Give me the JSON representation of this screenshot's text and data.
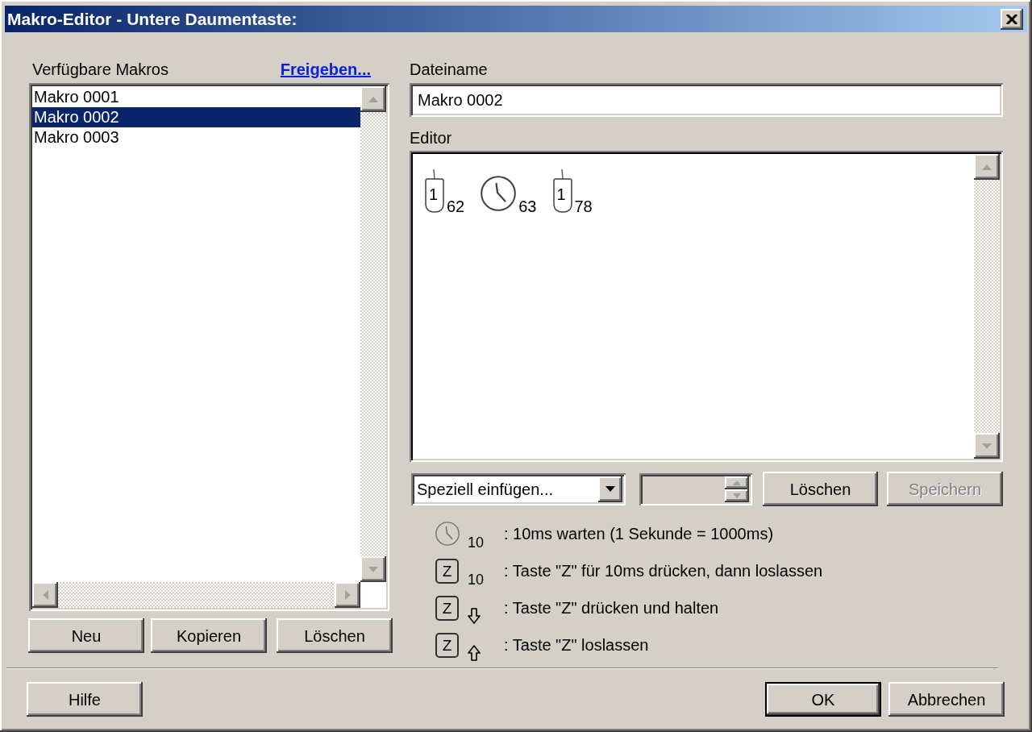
{
  "window": {
    "title": "Makro-Editor - Untere Daumentaste:"
  },
  "macros": {
    "label": "Verfügbare Makros",
    "share_link": "Freigeben...",
    "items": [
      {
        "name": "Makro 0001",
        "selected": false
      },
      {
        "name": "Makro 0002",
        "selected": true
      },
      {
        "name": "Makro 0003",
        "selected": false
      }
    ],
    "buttons": [
      {
        "label": "Neu"
      },
      {
        "label": "Kopieren"
      },
      {
        "label": "Löschen"
      }
    ]
  },
  "filename": {
    "label": "Dateiname",
    "value": "Makro 0002"
  },
  "editor": {
    "label": "Editor",
    "steps": [
      {
        "kind": "mouse",
        "button": "1",
        "value": "62"
      },
      {
        "kind": "wait",
        "value": "63"
      },
      {
        "kind": "mouse",
        "button": "1",
        "value": "78"
      }
    ]
  },
  "editor_controls": {
    "insert_dropdown": {
      "value": "Speziell einfügen..."
    },
    "spinner": {
      "disabled": true
    },
    "buttons": [
      {
        "label": "Löschen",
        "disabled": false
      },
      {
        "label": "Speichern",
        "disabled": true
      }
    ]
  },
  "legend": [
    {
      "kind": "wait",
      "value": "10",
      "text": ": 10ms warten (1 Sekunde = 1000ms)"
    },
    {
      "kind": "tap",
      "key": "Z",
      "value": "10",
      "text": ": Taste \"Z\" für 10ms drücken, dann loslassen"
    },
    {
      "kind": "press",
      "key": "Z",
      "text": ": Taste \"Z\" drücken und halten"
    },
    {
      "kind": "release",
      "key": "Z",
      "text": ": Taste \"Z\" loslassen"
    }
  ],
  "footer": {
    "help_button": {
      "label": "Hilfe"
    },
    "buttons": [
      {
        "label": "OK",
        "default": true
      },
      {
        "label": "Abbrechen",
        "default": false
      }
    ]
  }
}
